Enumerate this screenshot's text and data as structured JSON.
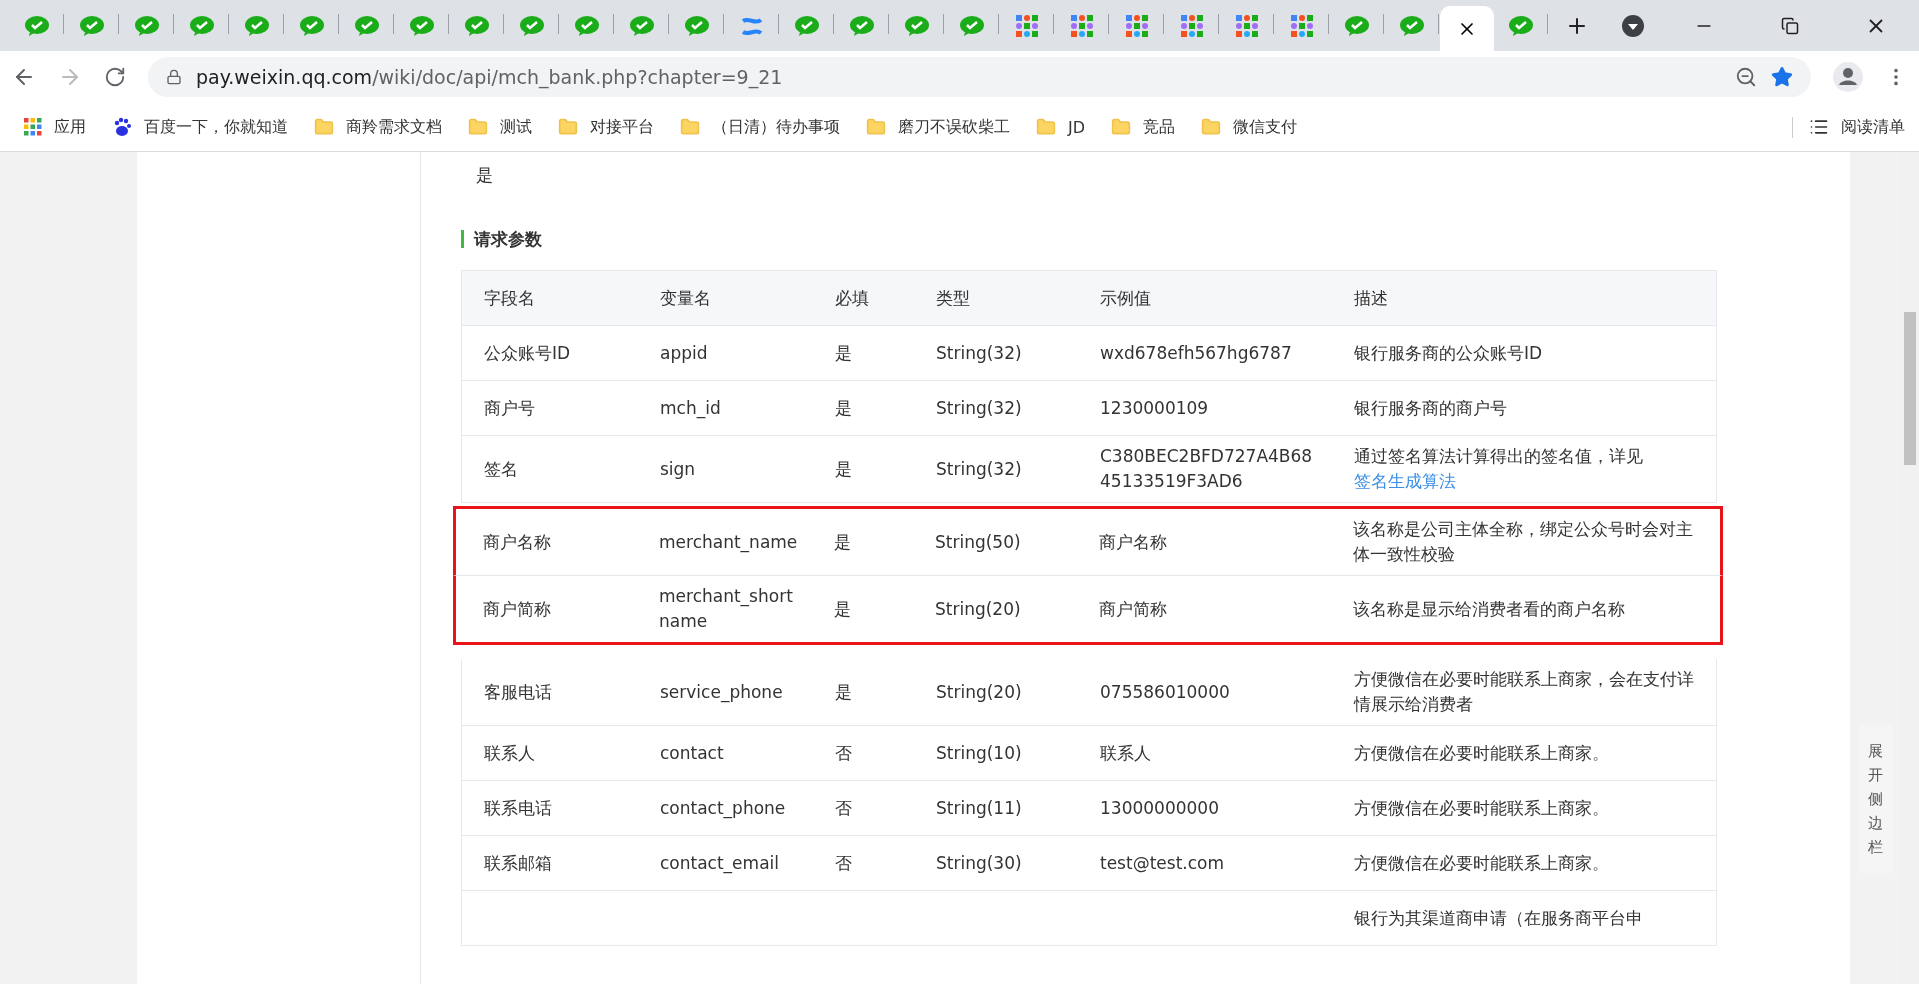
{
  "tabs": [
    {
      "kind": "wechat",
      "selected": false
    },
    {
      "kind": "wechat",
      "selected": false
    },
    {
      "kind": "wechat",
      "selected": false
    },
    {
      "kind": "wechat",
      "selected": false
    },
    {
      "kind": "wechat",
      "selected": false
    },
    {
      "kind": "wechat",
      "selected": false
    },
    {
      "kind": "wechat",
      "selected": false
    },
    {
      "kind": "wechat",
      "selected": false
    },
    {
      "kind": "wechat",
      "selected": false
    },
    {
      "kind": "wechat",
      "selected": false
    },
    {
      "kind": "wechat",
      "selected": false
    },
    {
      "kind": "wechat",
      "selected": false
    },
    {
      "kind": "wechat",
      "selected": false
    },
    {
      "kind": "confluence",
      "selected": false
    },
    {
      "kind": "wechat",
      "selected": false
    },
    {
      "kind": "wechat",
      "selected": false
    },
    {
      "kind": "wechat",
      "selected": false
    },
    {
      "kind": "wechat",
      "selected": false
    },
    {
      "kind": "grid",
      "selected": false
    },
    {
      "kind": "grid",
      "selected": false
    },
    {
      "kind": "grid",
      "selected": false
    },
    {
      "kind": "grid",
      "selected": false
    },
    {
      "kind": "grid",
      "selected": false
    },
    {
      "kind": "grid",
      "selected": false
    },
    {
      "kind": "wechat",
      "selected": false
    },
    {
      "kind": "wechat",
      "selected": false
    },
    {
      "selected": true
    },
    {
      "kind": "wechat",
      "selected": false
    }
  ],
  "address": {
    "host": "pay.weixin.qq.com",
    "path": "/wiki/doc/api/mch_bank.php?chapter=9_21"
  },
  "bookmarks": [
    {
      "kind": "apps",
      "label": "应用"
    },
    {
      "kind": "baidu",
      "label": "百度一下，你就知道"
    },
    {
      "kind": "folder",
      "label": "商羚需求文档"
    },
    {
      "kind": "folder",
      "label": "测试"
    },
    {
      "kind": "folder",
      "label": "对接平台"
    },
    {
      "kind": "folder",
      "label": "（日清）待办事项"
    },
    {
      "kind": "folder",
      "label": "磨刀不误砍柴工"
    },
    {
      "kind": "folder",
      "label": "JD"
    },
    {
      "kind": "folder",
      "label": "竞品"
    },
    {
      "kind": "folder",
      "label": "微信支付"
    }
  ],
  "reading_list": "阅读清单",
  "page": {
    "top_text": "是",
    "section_title": "请求参数",
    "table": {
      "columns": [
        "字段名",
        "变量名",
        "必填",
        "类型",
        "示例值",
        "描述"
      ],
      "rows": [
        {
          "highlighted": false,
          "cells": [
            "公众账号ID",
            "appid",
            "是",
            "String(32)",
            "wxd678efh567hg6787"
          ],
          "description": [
            {
              "text": "银行服务商的公众账号ID",
              "link": false
            }
          ]
        },
        {
          "highlighted": false,
          "cells": [
            "商户号",
            "mch_id",
            "是",
            "String(32)",
            "1230000109"
          ],
          "description": [
            {
              "text": "银行服务商的商户号",
              "link": false
            }
          ]
        },
        {
          "highlighted": false,
          "cells": [
            "签名",
            "sign",
            "是",
            "String(32)",
            "C380BEC2BFD727A4B6845133519F3AD6"
          ],
          "description": [
            {
              "text": "通过签名算法计算得出的签名值，详见",
              "link": false
            },
            {
              "text": "签名生成算法",
              "link": true
            }
          ]
        },
        {
          "highlighted": true,
          "cells": [
            "商户名称",
            "merchant_name",
            "是",
            "String(50)",
            "商户名称"
          ],
          "description": [
            {
              "text": "该名称是公司主体全称，绑定公众号时会对主体一致性校验",
              "link": false
            }
          ]
        },
        {
          "highlighted": true,
          "cells": [
            "商户简称",
            "merchant_shortname",
            "是",
            "String(20)",
            "商户简称"
          ],
          "description": [
            {
              "text": "该名称是显示给消费者看的商户名称",
              "link": false
            }
          ]
        },
        {
          "highlighted": false,
          "cells": [
            "客服电话",
            "service_phone",
            "是",
            "String(20)",
            "075586010000"
          ],
          "description": [
            {
              "text": "方便微信在必要时能联系上商家，会在支付详情展示给消费者",
              "link": false
            }
          ]
        },
        {
          "highlighted": false,
          "cells": [
            "联系人",
            "contact",
            "否",
            "String(10)",
            "联系人"
          ],
          "description": [
            {
              "text": "方便微信在必要时能联系上商家。",
              "link": false
            }
          ]
        },
        {
          "highlighted": false,
          "cells": [
            "联系电话",
            "contact_phone",
            "否",
            "String(11)",
            "13000000000"
          ],
          "description": [
            {
              "text": "方便微信在必要时能联系上商家。",
              "link": false
            }
          ]
        },
        {
          "highlighted": false,
          "cells": [
            "联系邮箱",
            "contact_email",
            "否",
            "String(30)",
            "test@test.com"
          ],
          "description": [
            {
              "text": "方便微信在必要时能联系上商家。",
              "link": false
            }
          ]
        },
        {
          "highlighted": false,
          "description": [
            {
              "text": "银行为其渠道商申请（在服务商平台申",
              "link": false
            }
          ]
        }
      ]
    }
  },
  "side_toggle": "展开侧边栏"
}
